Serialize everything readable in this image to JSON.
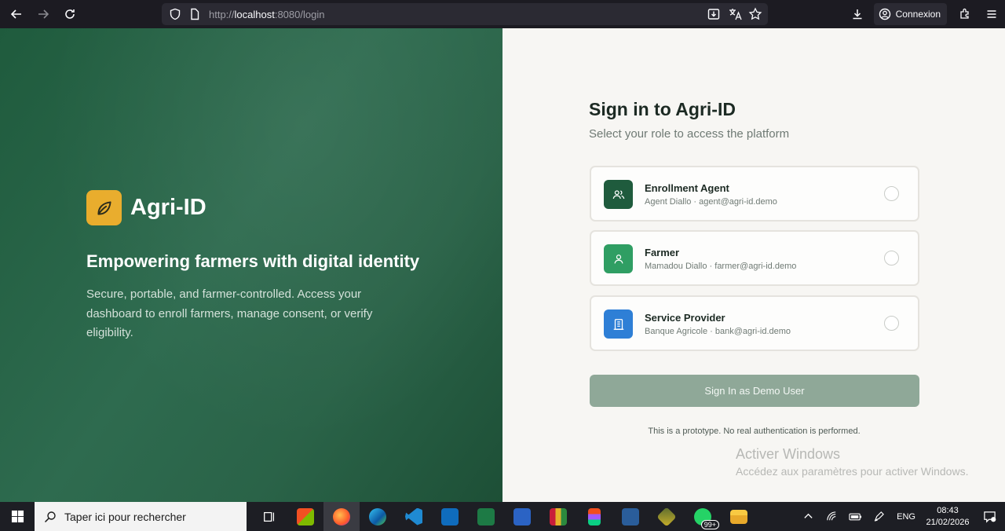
{
  "browser": {
    "url_prefix": "http://",
    "url_host": "localhost",
    "url_rest": ":8080/login",
    "connexion_label": "Connexion"
  },
  "hero": {
    "brand": "Agri-ID",
    "tagline": "Empowering farmers with digital identity",
    "description": "Secure, portable, and farmer-controlled. Access your dashboard to enroll farmers, manage consent, or verify eligibility.",
    "logo_color": "#e9ac2b"
  },
  "login": {
    "title": "Sign in to Agri-ID",
    "subtitle": "Select your role to access the platform",
    "roles": [
      {
        "name": "Enrollment Agent",
        "meta": "Agent Diallo · agent@agri-id.demo",
        "icon": "users-icon",
        "color": "#1f5b3d"
      },
      {
        "name": "Farmer",
        "meta": "Mamadou Diallo · farmer@agri-id.demo",
        "icon": "user-icon",
        "color": "#2f9e63"
      },
      {
        "name": "Service Provider",
        "meta": "Banque Agricole · bank@agri-id.demo",
        "icon": "building-icon",
        "color": "#2e7fd6"
      }
    ],
    "signin_label": "Sign In as Demo User",
    "note": "This is a prototype. No real authentication is performed."
  },
  "watermark": {
    "line1": "Activer Windows",
    "line2": "Accédez aux paramètres pour activer Windows."
  },
  "taskbar": {
    "search_placeholder": "Taper ici pour rechercher",
    "badge": "99+",
    "lang": "ENG",
    "time": "08:43",
    "date": "21/02/2026"
  }
}
